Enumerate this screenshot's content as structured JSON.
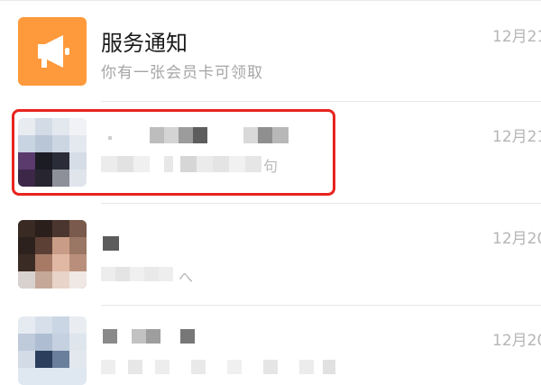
{
  "conversations": [
    {
      "title": "服务通知",
      "subtitle": "你有一张会员卡可领取",
      "time": "12月21",
      "icon": "megaphone-icon",
      "accent": "#ff9a3c"
    },
    {
      "title_hidden": true,
      "tail_char": "句",
      "time": "12月21",
      "highlighted": true,
      "highlight_color": "#e8231e"
    },
    {
      "title_hidden": true,
      "tail_char": "へ",
      "time": "12月20"
    },
    {
      "title_hidden": true,
      "time": "12月20"
    }
  ]
}
